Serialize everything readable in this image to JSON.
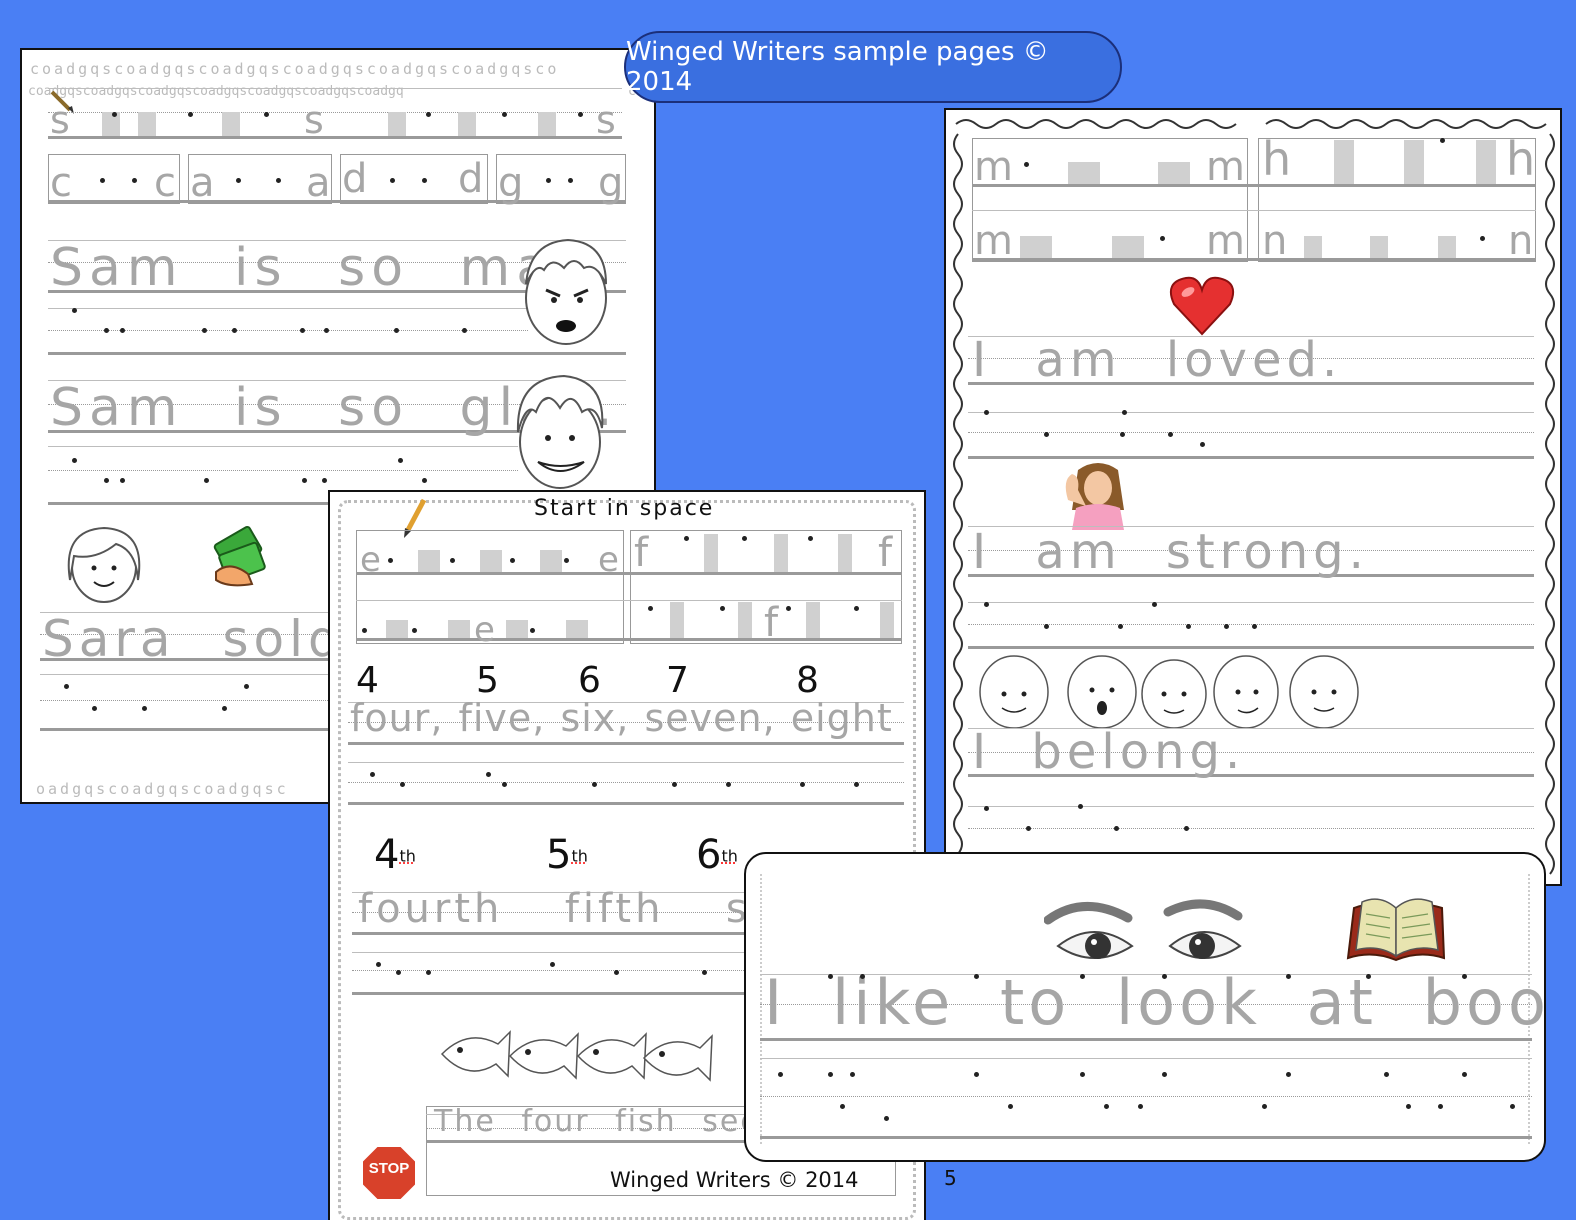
{
  "banner": {
    "title": "Winged Writers sample pages © 2014"
  },
  "left_page": {
    "border_letters": "coadgqscoadgqscoadgqscoadgqscoadgqscoadgqsco",
    "bottom_letters": "oadgqscoadgqscoadgqsc",
    "side_letters": "coadgqscoadgqscoadgqscoadgqscoadgqscoadgqscoadgq",
    "row1_letter": "s",
    "pairs": [
      "c",
      "a",
      "d",
      "g"
    ],
    "sentence1": "Sam is so mad.",
    "sentence2": "Sam is so glad.",
    "sentence3": "Sara sold"
  },
  "middle_page": {
    "header": "Start in space",
    "letter_e": "e",
    "letter_f": "f",
    "numbers": [
      "4",
      "5",
      "6",
      "7",
      "8"
    ],
    "number_words": "four, five, six, seven, eight",
    "ordinals": [
      {
        "num": "4",
        "sup": "th"
      },
      {
        "num": "5",
        "sup": "th"
      },
      {
        "num": "6",
        "sup": "th"
      }
    ],
    "ordinal_words": "fourth  fifth  six",
    "fish_sentence": "The four fish see",
    "stop_sign": "STOP",
    "footer": "Winged Writers ©  2014",
    "page_number": "5"
  },
  "right_page": {
    "letter_m": "m",
    "letter_h": "h",
    "letter_n": "n",
    "sentence1": "I am loved.",
    "sentence2": "I am strong.",
    "sentence3": "I belong."
  },
  "front_page": {
    "sentence": "I like to look at books."
  },
  "colors": {
    "background": "#4a7ff4",
    "banner": "#3a6fe0",
    "trace_text": "#a6a6a6"
  },
  "icons": [
    "pencil-icon",
    "angry-boy-icon",
    "happy-boy-icon",
    "girl-face-icon",
    "money-hand-icon",
    "heart-icon",
    "strong-girl-photo",
    "faces-row-icon",
    "fish-icon",
    "stop-sign-icon",
    "eyes-icon",
    "book-icon"
  ]
}
